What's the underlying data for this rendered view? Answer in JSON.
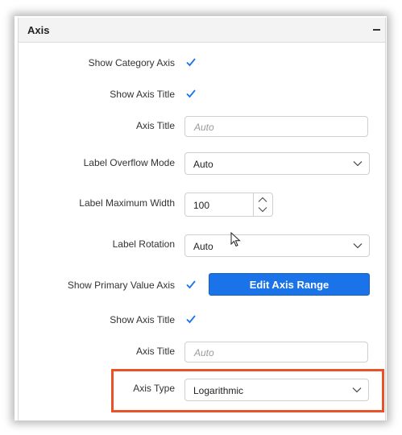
{
  "panel": {
    "title": "Axis"
  },
  "fields": {
    "show_category_axis": {
      "label": "Show Category Axis",
      "checked": true
    },
    "show_axis_title_1": {
      "label": "Show Axis Title",
      "checked": true
    },
    "axis_title_1": {
      "label": "Axis Title",
      "value": "",
      "placeholder": "Auto"
    },
    "label_overflow_mode": {
      "label": "Label Overflow Mode",
      "value": "Auto"
    },
    "label_max_width": {
      "label": "Label Maximum Width",
      "value": "100"
    },
    "label_rotation": {
      "label": "Label Rotation",
      "value": "Auto"
    },
    "show_primary_value_axis": {
      "label": "Show Primary Value Axis",
      "checked": true
    },
    "edit_axis_range": {
      "label": "Edit Axis Range"
    },
    "show_axis_title_2": {
      "label": "Show Axis Title",
      "checked": true
    },
    "axis_title_2": {
      "label": "Axis Title",
      "value": "",
      "placeholder": "Auto"
    },
    "axis_type": {
      "label": "Axis Type",
      "value": "Logarithmic"
    }
  },
  "colors": {
    "accent": "#1a73e8",
    "highlight": "#e8512a",
    "checkmark": "#1a73e8"
  },
  "icons": {
    "collapse": "minus-icon",
    "checkbox": "checkmark-icon",
    "dropdown": "chevron-down-icon",
    "spin_up": "chevron-up-icon",
    "spin_down": "chevron-down-icon",
    "cursor": "mouse-pointer-icon"
  }
}
